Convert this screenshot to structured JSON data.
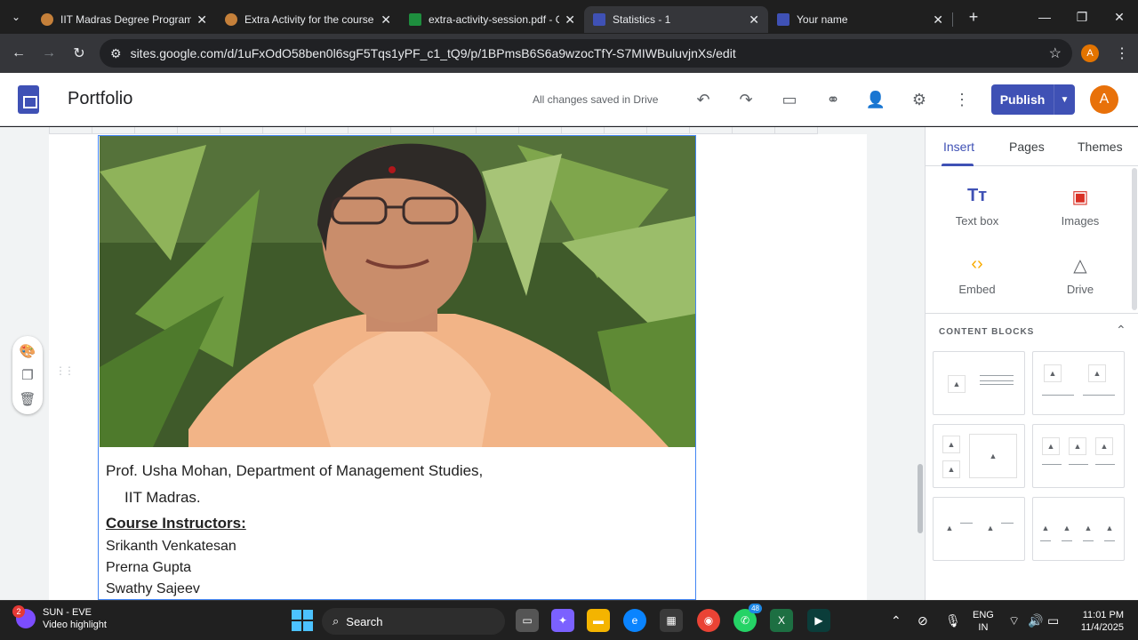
{
  "browser": {
    "tabs": [
      {
        "title": "IIT Madras Degree Program",
        "fav_color": "#c5803a"
      },
      {
        "title": "Extra Activity for the course",
        "fav_color": "#c5803a"
      },
      {
        "title": "extra-activity-session.pdf - G",
        "fav_color": "#1e8e3e"
      },
      {
        "title": "Statistics - 1",
        "fav_color": "#3f51b5"
      },
      {
        "title": "Your name",
        "fav_color": "#3f51b5"
      }
    ],
    "active_tab": 3,
    "url": "sites.google.com/d/1uFxOdO58ben0l6sgF5Tqs1yPF_c1_tQ9/p/1BPmsB6S6a9wzocTfY-S7MIWBuluvjnXs/edit",
    "profile_initial": "A"
  },
  "sites": {
    "site_name": "Portfolio",
    "save_status": "All changes saved in Drive",
    "publish_label": "Publish",
    "account_initial": "A"
  },
  "content": {
    "caption_line1": "Prof. Usha Mohan,  Department of Management Studies,",
    "caption_line2": "IIT Madras.",
    "instructors_heading": "Course Instructors:",
    "instructors": [
      "Srikanth Venkatesan",
      "Prerna Gupta",
      "Swathy Sajeev"
    ]
  },
  "panel": {
    "tabs": [
      "Insert",
      "Pages",
      "Themes"
    ],
    "insert_items": [
      {
        "label": "Text box",
        "icon": "text-box-icon"
      },
      {
        "label": "Images",
        "icon": "image-icon"
      },
      {
        "label": "Embed",
        "icon": "embed-icon"
      },
      {
        "label": "Drive",
        "icon": "drive-icon"
      }
    ],
    "content_blocks_heading": "CONTENT BLOCKS"
  },
  "taskbar": {
    "weather_badge": "2",
    "weather_title": "SUN - EVE",
    "weather_subtitle": "Video highlight",
    "search_placeholder": "Search",
    "whatsapp_count": "48",
    "lang_line1": "ENG",
    "lang_line2": "IN",
    "time": "11:01 PM",
    "date": "11/4/2025"
  },
  "colors": {
    "accent": "#3f51b5",
    "account": "#e8710a"
  }
}
